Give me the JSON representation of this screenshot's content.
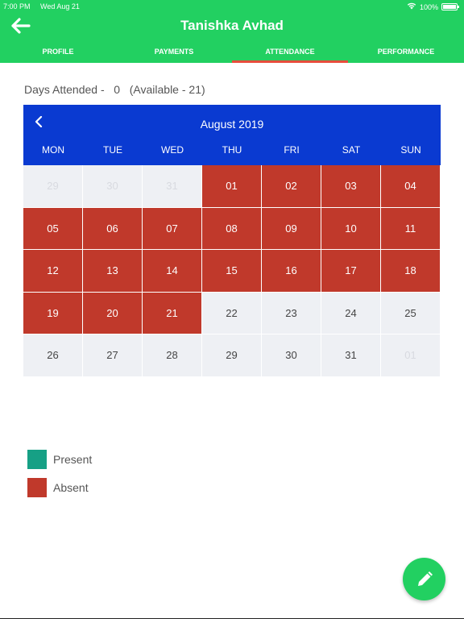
{
  "status_bar": {
    "time": "7:00 PM",
    "date": "Wed Aug 21",
    "battery": "100%"
  },
  "header": {
    "title": "Tanishka Avhad"
  },
  "tabs": [
    {
      "label": "PROFILE",
      "active": false
    },
    {
      "label": "PAYMENTS",
      "active": false
    },
    {
      "label": "ATTENDANCE",
      "active": true
    },
    {
      "label": "PERFORMANCE",
      "active": false
    }
  ],
  "attendance": {
    "summary": "Days Attended -   0   (Available - 21)"
  },
  "calendar": {
    "month": "August 2019",
    "weekdays": [
      "MON",
      "TUE",
      "WED",
      "THU",
      "FRI",
      "SAT",
      "SUN"
    ],
    "days": [
      {
        "label": "29",
        "status": "other"
      },
      {
        "label": "30",
        "status": "other"
      },
      {
        "label": "31",
        "status": "other"
      },
      {
        "label": "01",
        "status": "absent"
      },
      {
        "label": "02",
        "status": "absent"
      },
      {
        "label": "03",
        "status": "absent"
      },
      {
        "label": "04",
        "status": "absent"
      },
      {
        "label": "05",
        "status": "absent"
      },
      {
        "label": "06",
        "status": "absent"
      },
      {
        "label": "07",
        "status": "absent"
      },
      {
        "label": "08",
        "status": "absent"
      },
      {
        "label": "09",
        "status": "absent"
      },
      {
        "label": "10",
        "status": "absent"
      },
      {
        "label": "11",
        "status": "absent"
      },
      {
        "label": "12",
        "status": "absent"
      },
      {
        "label": "13",
        "status": "absent"
      },
      {
        "label": "14",
        "status": "absent"
      },
      {
        "label": "15",
        "status": "absent"
      },
      {
        "label": "16",
        "status": "absent"
      },
      {
        "label": "17",
        "status": "absent"
      },
      {
        "label": "18",
        "status": "absent"
      },
      {
        "label": "19",
        "status": "absent"
      },
      {
        "label": "20",
        "status": "absent"
      },
      {
        "label": "21",
        "status": "absent"
      },
      {
        "label": "22",
        "status": "none"
      },
      {
        "label": "23",
        "status": "none"
      },
      {
        "label": "24",
        "status": "none"
      },
      {
        "label": "25",
        "status": "none"
      },
      {
        "label": "26",
        "status": "none"
      },
      {
        "label": "27",
        "status": "none"
      },
      {
        "label": "28",
        "status": "none"
      },
      {
        "label": "29",
        "status": "none"
      },
      {
        "label": "30",
        "status": "none"
      },
      {
        "label": "31",
        "status": "none"
      },
      {
        "label": "01",
        "status": "other"
      }
    ]
  },
  "legend": [
    {
      "label": "Present",
      "color": "#16a085"
    },
    {
      "label": "Absent",
      "color": "#c0392b"
    }
  ],
  "icons": {
    "back": "arrow-left-icon",
    "prev": "chevron-left-icon",
    "fab": "pencil-icon"
  }
}
